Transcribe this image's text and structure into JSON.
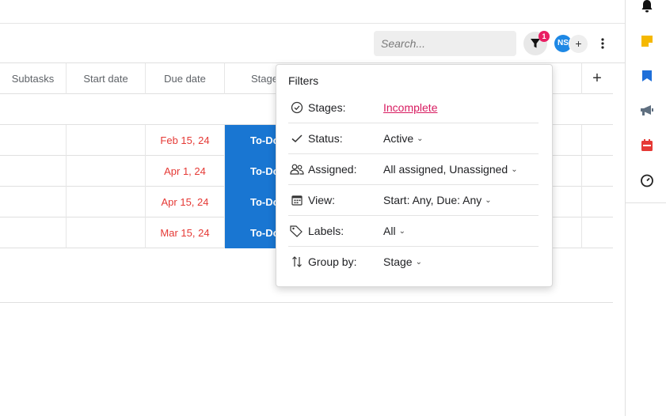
{
  "toolbar": {
    "search_placeholder": "Search...",
    "filter_badge": "1",
    "avatar_initials": "NS",
    "avatar_add": "+"
  },
  "table": {
    "columns": [
      "Subtasks",
      "Start date",
      "Due date",
      "Stage"
    ],
    "add_column": "+",
    "rows": [
      {
        "subtasks": "",
        "start_date": "",
        "due_date": "Feb 15, 24",
        "stage": "To-Do"
      },
      {
        "subtasks": "",
        "start_date": "",
        "due_date": "Apr 1, 24",
        "stage": "To-Do"
      },
      {
        "subtasks": "",
        "start_date": "",
        "due_date": "Apr 15, 24",
        "stage": "To-Do"
      },
      {
        "subtasks": "",
        "start_date": "",
        "due_date": "Mar 15, 24",
        "stage": "To-Do"
      }
    ]
  },
  "filters": {
    "title": "Filters",
    "items": [
      {
        "icon": "check-circle-icon",
        "label": "Stages:",
        "value": "Incomplete"
      },
      {
        "icon": "check-icon",
        "label": "Status:",
        "value": "Active"
      },
      {
        "icon": "people-icon",
        "label": "Assigned:",
        "value": "All assigned, Unassigned"
      },
      {
        "icon": "calendar-icon",
        "label": "View:",
        "value": "Start: Any, Due: Any"
      },
      {
        "icon": "tag-icon",
        "label": "Labels:",
        "value": "All"
      },
      {
        "icon": "sort-icon",
        "label": "Group by:",
        "value": "Stage"
      }
    ]
  },
  "rail": {
    "icons": [
      "bell-icon",
      "sticky-note-icon",
      "bookmark-icon",
      "megaphone-icon",
      "calendar-icon",
      "timer-icon"
    ]
  },
  "colors": {
    "accent": "#1976d2",
    "due_text": "#e53935",
    "filter_link": "#d81b60",
    "badge": "#e91e63"
  }
}
